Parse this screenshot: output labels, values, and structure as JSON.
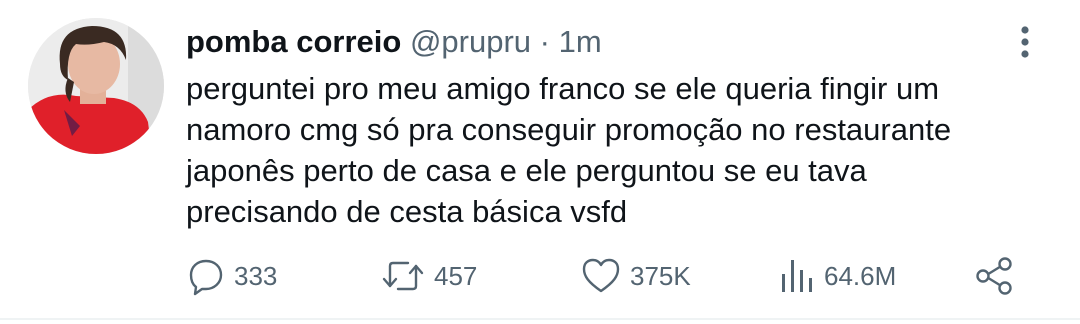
{
  "tweet": {
    "display_name": "pomba correio",
    "handle": "@prupru",
    "separator": "·",
    "timestamp": "1m",
    "text_lines": [
      "perguntei pro meu amigo franco se ele queria fingir um",
      "namoro cmg só pra conseguir promoção no restaurante",
      "japonês perto de casa e ele perguntou se eu tava",
      "precisando de cesta básica vsfd"
    ]
  },
  "actions": {
    "reply_icon": "speech-bubble-icon",
    "reply_count": "333",
    "retweet_icon": "retweet-arrows-icon",
    "retweet_count": "457",
    "like_icon": "heart-icon",
    "like_count": "375K",
    "views_icon": "bar-chart-icon",
    "views_count": "64.6M",
    "share_icon": "share-nodes-icon"
  },
  "colors": {
    "text": "#0f1419",
    "muted": "#536471",
    "avatar_shirt": "#e0202a",
    "divider": "#eff3f4"
  }
}
